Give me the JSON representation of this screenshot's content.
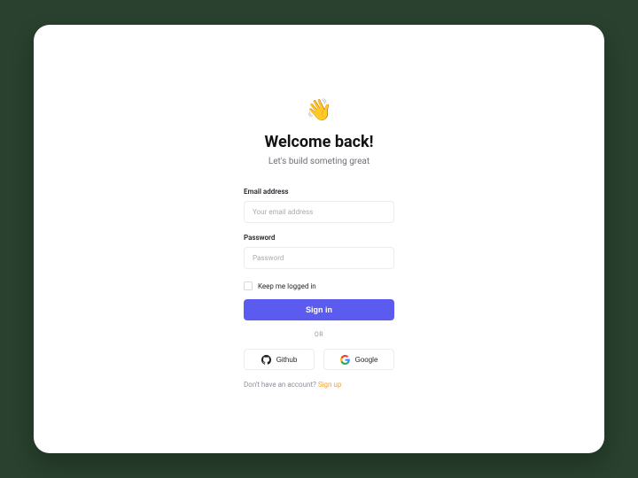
{
  "header": {
    "icon": "👋",
    "title": "Welcome back!",
    "subtitle": "Let's build someting great"
  },
  "form": {
    "email_label": "Email address",
    "email_placeholder": "Your email address",
    "password_label": "Password",
    "password_placeholder": "Password",
    "remember_label": "Keep me logged in",
    "signin_label": "Sign in",
    "or_label": "OR",
    "github_label": "Github",
    "google_label": "Google"
  },
  "signup": {
    "prompt": "Don't have an account? ",
    "link": "Sign up"
  }
}
